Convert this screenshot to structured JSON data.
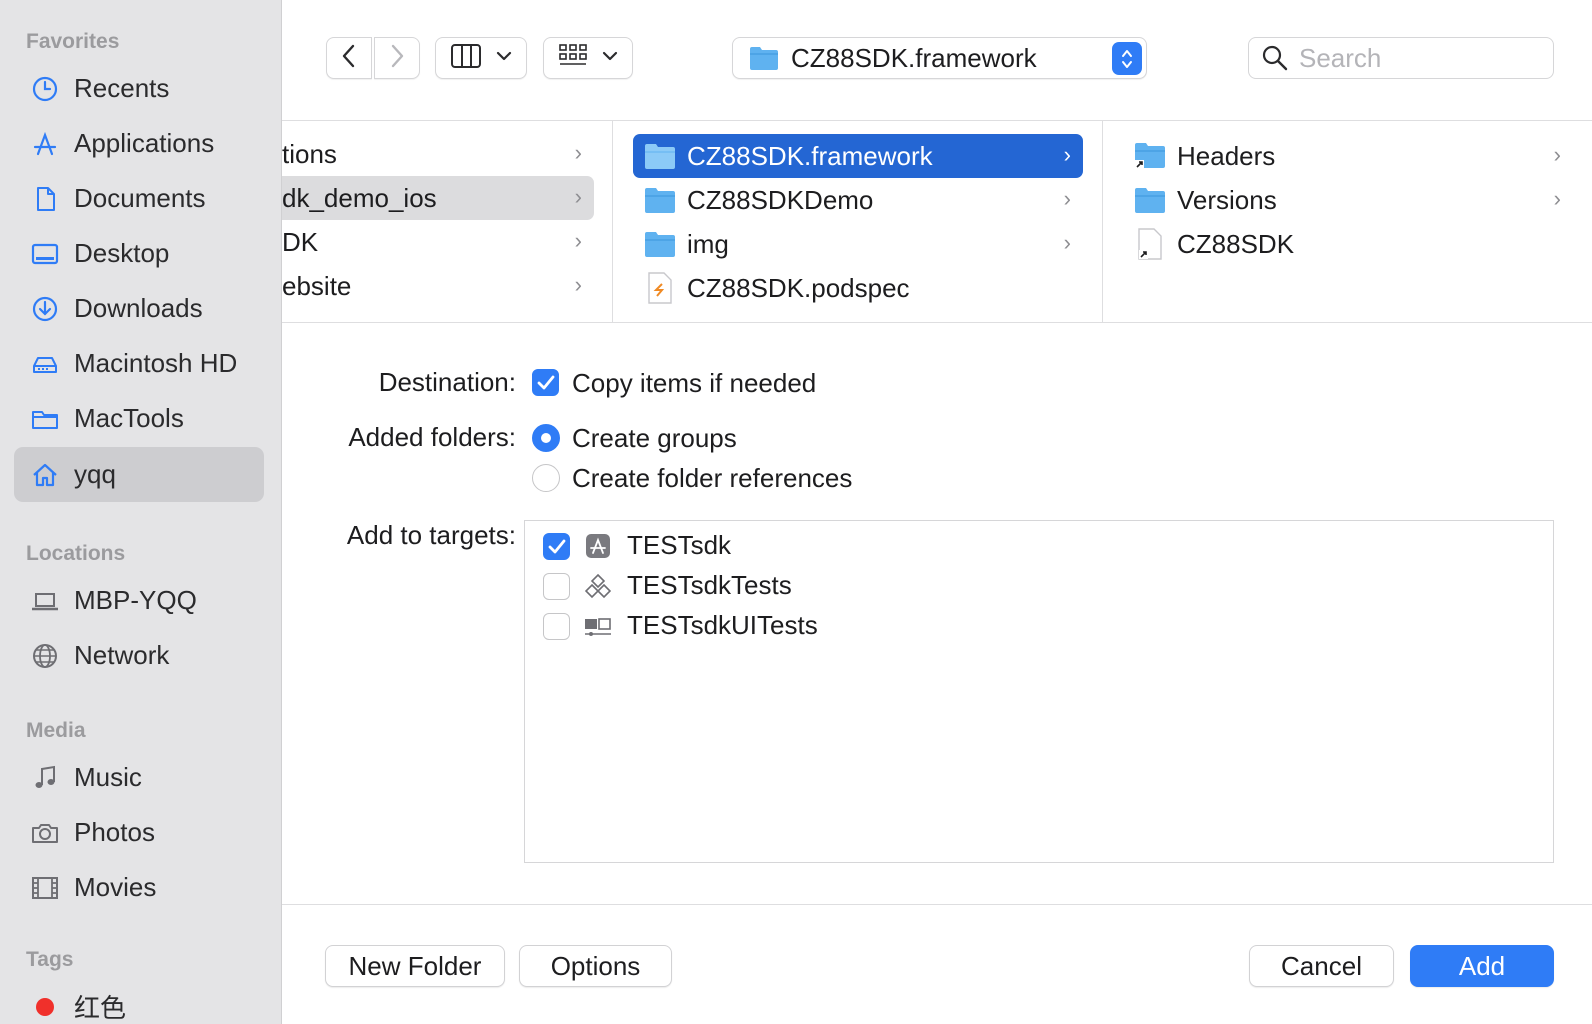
{
  "sidebar": {
    "favorites_title": "Favorites",
    "favorites": [
      {
        "label": "Recents",
        "icon": "clock-icon"
      },
      {
        "label": "Applications",
        "icon": "applications-icon"
      },
      {
        "label": "Documents",
        "icon": "document-icon"
      },
      {
        "label": "Desktop",
        "icon": "desktop-icon"
      },
      {
        "label": "Downloads",
        "icon": "download-icon"
      },
      {
        "label": "Macintosh HD",
        "icon": "hard-drive-icon"
      },
      {
        "label": "MacTools",
        "icon": "folder-icon"
      },
      {
        "label": "yqq",
        "icon": "home-icon",
        "selected": true
      }
    ],
    "locations_title": "Locations",
    "locations": [
      {
        "label": "MBP-YQQ",
        "icon": "laptop-icon"
      },
      {
        "label": "Network",
        "icon": "globe-icon"
      }
    ],
    "media_title": "Media",
    "media": [
      {
        "label": "Music",
        "icon": "music-note-icon"
      },
      {
        "label": "Photos",
        "icon": "camera-icon"
      },
      {
        "label": "Movies",
        "icon": "film-icon"
      }
    ],
    "tags_title": "Tags",
    "tags": [
      {
        "label": "红色",
        "color": "#f0302b"
      }
    ]
  },
  "toolbar": {
    "path_label": "CZ88SDK.framework",
    "search_placeholder": "Search"
  },
  "browser": {
    "col1": [
      {
        "label": "tions",
        "chevron": true
      },
      {
        "label": "dk_demo_ios",
        "chevron": true,
        "highlighted": true
      },
      {
        "label": "DK",
        "chevron": true
      },
      {
        "label": "ebsite",
        "chevron": true
      }
    ],
    "col2": [
      {
        "label": "CZ88SDK.framework",
        "type": "folder",
        "chevron": true,
        "selected": true
      },
      {
        "label": "CZ88SDKDemo",
        "type": "folder",
        "chevron": true
      },
      {
        "label": "img",
        "type": "folder",
        "chevron": true
      },
      {
        "label": "CZ88SDK.podspec",
        "type": "file",
        "chevron": false
      }
    ],
    "col3": [
      {
        "label": "Headers",
        "type": "alias-folder",
        "chevron": true
      },
      {
        "label": "Versions",
        "type": "folder",
        "chevron": true
      },
      {
        "label": "CZ88SDK",
        "type": "alias-file",
        "chevron": false
      }
    ]
  },
  "options": {
    "destination_label": "Destination:",
    "copy_items_label": "Copy items if needed",
    "copy_items_checked": true,
    "added_folders_label": "Added folders:",
    "create_groups_label": "Create groups",
    "create_folder_refs_label": "Create folder references",
    "selected_folder_option": "create-groups",
    "add_to_targets_label": "Add to targets:",
    "targets": [
      {
        "label": "TESTsdk",
        "checked": true,
        "icon": "app-target-icon"
      },
      {
        "label": "TESTsdkTests",
        "checked": false,
        "icon": "unit-test-target-icon"
      },
      {
        "label": "TESTsdkUITests",
        "checked": false,
        "icon": "ui-test-target-icon"
      }
    ]
  },
  "buttons": {
    "new_folder": "New Folder",
    "options": "Options",
    "cancel": "Cancel",
    "add": "Add"
  },
  "colors": {
    "accent": "#2f7cf6",
    "selection": "#2466d3",
    "sidebar_bg": "#e4e4e6",
    "folder_blue": "#5fb2f0"
  }
}
